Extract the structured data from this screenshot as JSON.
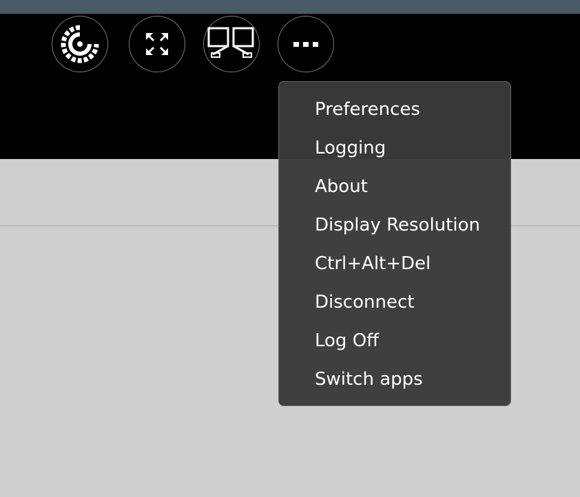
{
  "toolbar": {
    "buttons": [
      {
        "name": "citrix-logo",
        "icon": "citrix-logo-icon"
      },
      {
        "name": "fullscreen",
        "icon": "fullscreen-icon"
      },
      {
        "name": "multi-monitor",
        "icon": "multi-monitor-icon"
      },
      {
        "name": "more",
        "icon": "more-options-icon"
      }
    ]
  },
  "menu": {
    "items": [
      {
        "label": "Preferences"
      },
      {
        "label": "Logging"
      },
      {
        "label": "About"
      },
      {
        "label": "Display Resolution"
      },
      {
        "label": "Ctrl+Alt+Del"
      },
      {
        "label": "Disconnect"
      },
      {
        "label": "Log Off"
      },
      {
        "label": "Switch apps"
      }
    ]
  },
  "colors": {
    "toolbar_bg": "#000000",
    "top_strip": "#485a63",
    "desktop_bg": "#cfcfcf",
    "menu_bg": "#3a3a3a",
    "menu_text": "#ffffff"
  }
}
